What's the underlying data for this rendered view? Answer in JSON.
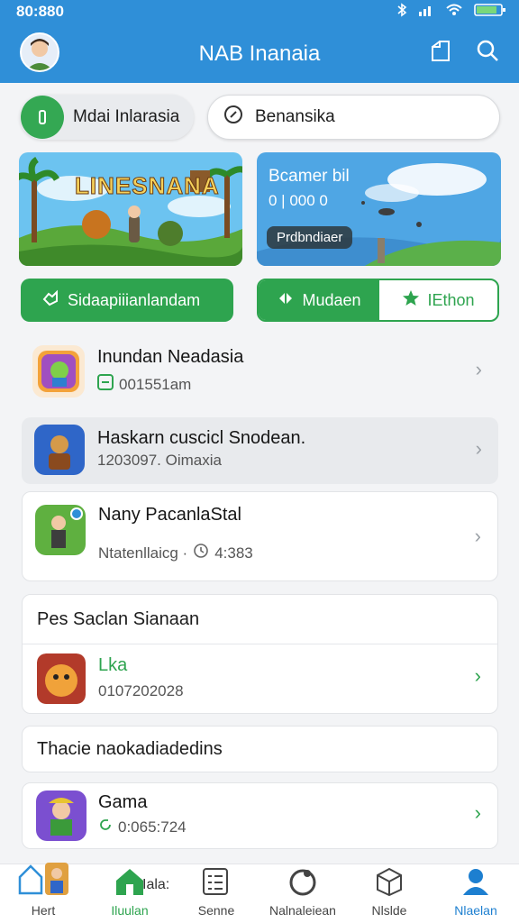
{
  "status": {
    "time": "80:880"
  },
  "header": {
    "title": "NAB Inanaia"
  },
  "toggles": {
    "left_label": "Mdai Inlarasia",
    "right_label": "Benansika"
  },
  "banners": {
    "left": {
      "game_title": "LINESNANA"
    },
    "right": {
      "title": "Bcamer bil",
      "subtitle": "0 | 000 0",
      "chip": "Prdbndiaer"
    }
  },
  "actions": {
    "primary": "Sidaapiiianlandam",
    "seg1": "Mudaen",
    "seg2": "IEthon"
  },
  "items": [
    {
      "title": "Inundan Neadasia",
      "sub": "001551am"
    },
    {
      "title": "Haskarn cuscicl Snodean.",
      "sub": "1203097. Oimaxia"
    },
    {
      "title": "Nany PacanlaStal",
      "sub": "Ntatenllaicg ·",
      "sub_time": "4:383"
    }
  ],
  "section1": {
    "header": "Pes Saclan Sianaan",
    "item": {
      "title": "Lka",
      "sub": "0107202028"
    }
  },
  "section2": {
    "header": "Thacie naokadiadedins",
    "item": {
      "title": "Gama",
      "sub": "0:065:724"
    }
  },
  "nav": [
    {
      "label": "Hert"
    },
    {
      "label": "Iluulan",
      "badge": "Iala:"
    },
    {
      "label": "Senne"
    },
    {
      "label": "Nalnaleiean"
    },
    {
      "label": "Nlslde"
    },
    {
      "label": "Nlaelan"
    }
  ],
  "colors": {
    "primary_blue": "#2f8fd8",
    "green": "#2ea44f",
    "active_nav": "#1d7fd0"
  }
}
